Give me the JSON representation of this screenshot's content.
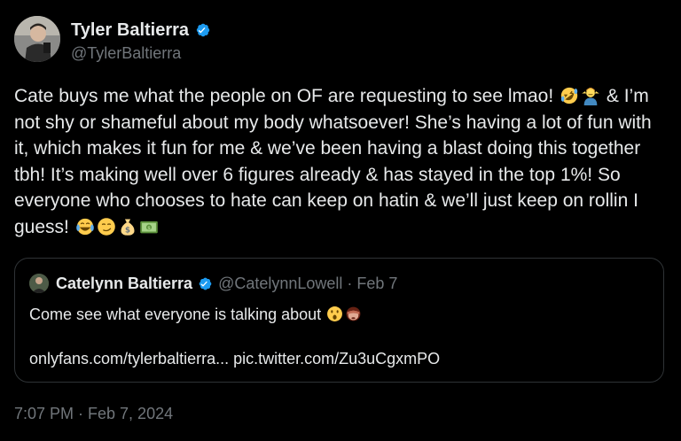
{
  "author": {
    "name": "Tyler Baltierra",
    "handle": "@TylerBaltierra",
    "verified_color": "#1d9bf0"
  },
  "tweet": {
    "text_part1": "Cate buys me what the people on OF are requesting to see lmao! ",
    "text_part2": " & I’m not shy or shameful about my body whatsoever! She’s having a lot of fun with it, which makes it fun for me & we’ve been having a blast doing this together tbh! It’s making well over 6 figures already & has stayed in the top 1%! So everyone who chooses to hate can keep on hatin & we’ll just keep on rollin I guess! ",
    "emojis_1": [
      "rofl-emoji",
      "person-shrugging-emoji"
    ],
    "emojis_2": [
      "joy-emoji",
      "smirk-emoji",
      "money-bag-emoji",
      "dollar-banknote-emoji"
    ]
  },
  "quote": {
    "name": "Catelynn Baltierra",
    "handle": "@CatelynnLowell",
    "separator": "·",
    "date": "Feb 7",
    "text": "Come see what everyone is talking about ",
    "emojis": [
      "hushed-face-emoji",
      "see-no-evil-monkey-emoji"
    ],
    "link": "onlyfans.com/tylerbaltierra... pic.twitter.com/Zu3uCgxmPO"
  },
  "timestamp": "7:07 PM · Feb 7, 2024",
  "colors": {
    "background": "#000000",
    "text": "#e7e9ea",
    "secondary": "#71767b",
    "border": "#2f3336"
  }
}
